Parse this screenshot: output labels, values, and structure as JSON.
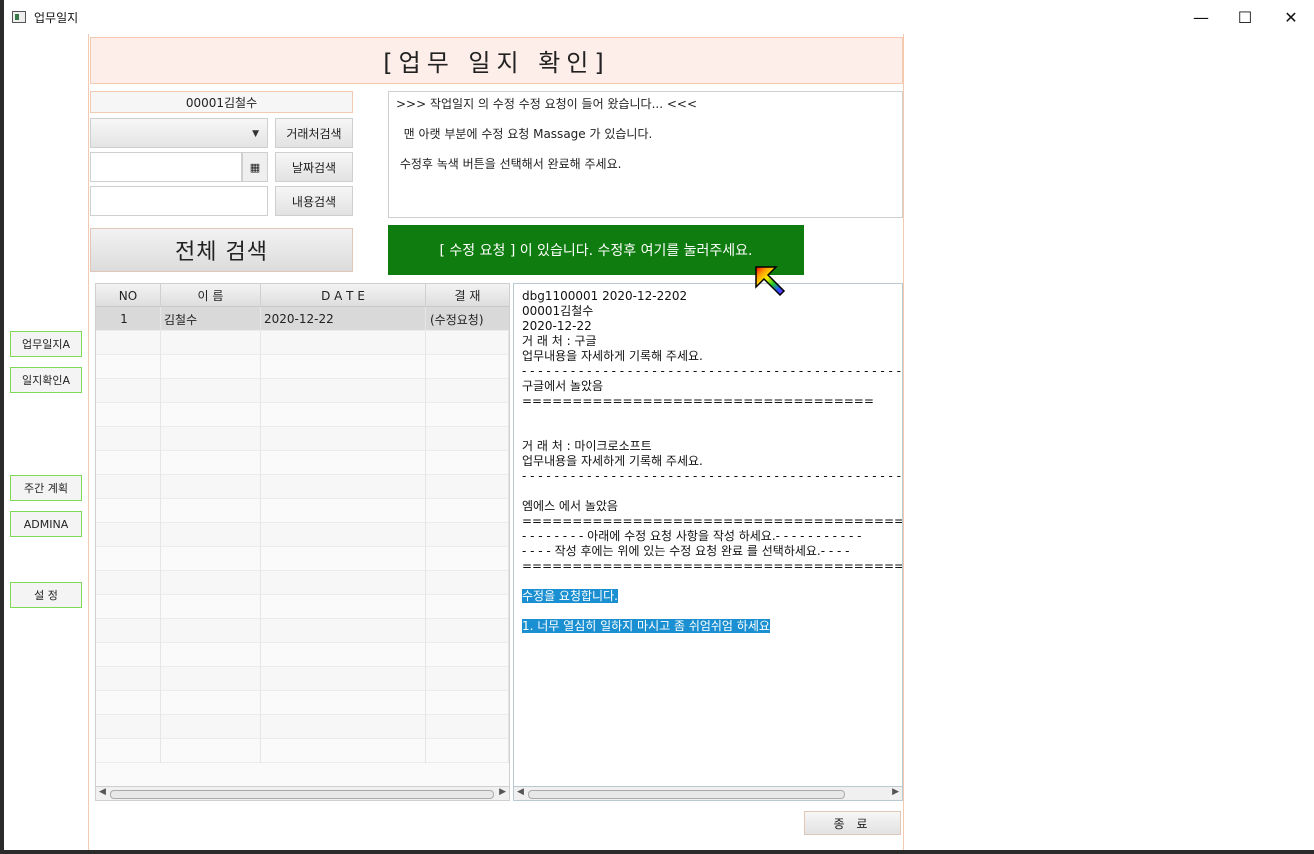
{
  "window": {
    "title": "업무일지",
    "minimize": "—",
    "maximize": "☐",
    "close": "✕"
  },
  "sidebar": {
    "items": [
      {
        "label": "업무일지A"
      },
      {
        "label": "일지확인A"
      },
      {
        "label": "주간 계획"
      },
      {
        "label": "ADMINA"
      },
      {
        "label": "설  정"
      }
    ]
  },
  "header": {
    "title": "[업무  일지  확인]"
  },
  "search": {
    "user": "00001김철수",
    "client_button": "거래처검색",
    "date_button": "날짜검색",
    "content_button": "내용검색",
    "full_button": "전체 검색",
    "calendar_icon": "▦",
    "combo_arrow": "▼"
  },
  "notice": {
    "lines": [
      ">>> 작업일지 의 수정 수정 요청이 들어 왔습니다... <<<",
      "  맨 아랫 부분에 수정 요청 Massage 가 있습니다.",
      " 수정후 녹색 버튼을 선택해서 완료해 주세요."
    ]
  },
  "action": {
    "label": "[ 수정 요청 ] 이 있습니다. 수정후 여기를 눌러주세요."
  },
  "table": {
    "headers": [
      "NO",
      "이  름",
      "D A T E",
      "결 재"
    ],
    "rows": [
      [
        "1",
        "김철수",
        "2020-12-22",
        "(수정요청)"
      ]
    ]
  },
  "log": {
    "lines": [
      "dbg1100001 2020-12-2202",
      "00001김철수",
      "2020-12-22",
      "거 래 처 : 구글",
      "업무내용을 자세하게 기록해 주세요.",
      "- - - - - - - - - - - - - - - - - - - - - - - - - - - - - - - - - - - - - - - - - - - - - - - - - -",
      "구글에서 놀았음",
      "===================================",
      "",
      "",
      "거 래 처 : 마이크로소프트",
      "업무내용을 자세하게 기록해 주세요.",
      "- - - - - - - - - - - - - - - - - - - - - - - - - - - - - - - - - - - - - - - - - - - - - - - - - -",
      "",
      "엠에스 에서 놀았음",
      "===========================================",
      "- - - - - - - - 아래에 수정 요청 사항을 작성 하세요.- - - - - - - - - - -",
      "- - - - 작성 후에는 위에 있는 수정 요청 완료 를 선택하세요.- - - -",
      "===========================================",
      "",
      "수정을 요청합니다.",
      "",
      "1. 너무 열심히 일하지 마시고 좀 쉬엄쉬엄 하세요"
    ],
    "highlight_color": "#1a8fd1"
  },
  "footer": {
    "close_button": "종  료"
  }
}
